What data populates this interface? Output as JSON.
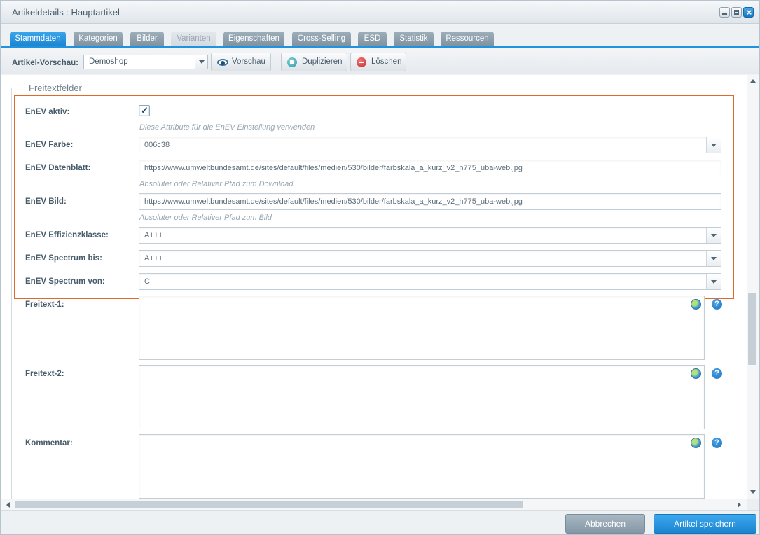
{
  "window": {
    "title": "Artikeldetails : Hauptartikel",
    "controls": [
      "minimize-icon",
      "maximize-icon",
      "close-icon"
    ]
  },
  "tabs": [
    {
      "label": "Stammdaten",
      "state": "active"
    },
    {
      "label": "Kategorien",
      "state": "normal"
    },
    {
      "label": "Bilder",
      "state": "normal"
    },
    {
      "label": "Varianten",
      "state": "disabled"
    },
    {
      "label": "Eigenschaften",
      "state": "normal"
    },
    {
      "label": "Cross-Selling",
      "state": "normal"
    },
    {
      "label": "ESD",
      "state": "normal"
    },
    {
      "label": "Statistik",
      "state": "normal"
    },
    {
      "label": "Ressourcen",
      "state": "normal"
    }
  ],
  "toolbar": {
    "preview_label": "Artikel-Vorschau:",
    "shop_select_value": "Demoshop",
    "preview_button": "Vorschau",
    "duplicate_button": "Duplizieren",
    "delete_button": "Löschen"
  },
  "fieldset": {
    "legend": "Freitextfelder"
  },
  "fields": {
    "enev_aktiv": {
      "label": "EnEV aktiv:",
      "checked": true,
      "help": "Diese Attribute für die EnEV Einstellung verwenden"
    },
    "enev_farbe": {
      "label": "EnEV Farbe:",
      "value": "006c38"
    },
    "enev_datenblatt": {
      "label": "EnEV Datenblatt:",
      "value": "https://www.umweltbundesamt.de/sites/default/files/medien/530/bilder/farbskala_a_kurz_v2_h775_uba-web.jpg",
      "help": "Absoluter oder Relativer Pfad zum Download"
    },
    "enev_bild": {
      "label": "EnEV Bild:",
      "value": "https://www.umweltbundesamt.de/sites/default/files/medien/530/bilder/farbskala_a_kurz_v2_h775_uba-web.jpg",
      "help": "Absoluter oder Relativer Pfad zum Bild"
    },
    "enev_effizienzklasse": {
      "label": "EnEV Effizienzklasse:",
      "value": "A+++"
    },
    "enev_spectrum_bis": {
      "label": "EnEV Spectrum bis:",
      "value": "A+++"
    },
    "enev_spectrum_von": {
      "label": "EnEV Spectrum von:",
      "value": "C"
    },
    "freitext_1": {
      "label": "Freitext-1:",
      "value": ""
    },
    "freitext_2": {
      "label": "Freitext-2:",
      "value": ""
    },
    "kommentar": {
      "label": "Kommentar:",
      "value": ""
    }
  },
  "icons": {
    "translation": "globe-icon",
    "help": "help-icon",
    "help_glyph": "?",
    "checkmark": "✓"
  },
  "footer": {
    "cancel_button": "Abbrechen",
    "save_button": "Artikel speichern"
  },
  "colors": {
    "accent": "#1f93e0",
    "highlight_border": "#e06a2c",
    "cancel": "#8c9eab"
  }
}
